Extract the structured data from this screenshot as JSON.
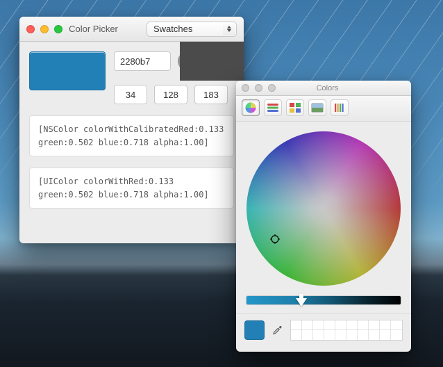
{
  "picker": {
    "title": "Color Picker",
    "dropdown": {
      "selected": "Swatches"
    },
    "hex": "2280b7",
    "rgb": {
      "r": "34",
      "g": "128",
      "b": "183"
    },
    "nscolor_code": "[NSColor colorWithCalibratedRed:0.133 green:0.502 blue:0.718 alpha:1.00]",
    "uicolor_code": "[UIColor colorWithRed:0.133 green:0.502 blue:0.718 alpha:1.00]",
    "swatch_color": "#2280b7"
  },
  "colors_panel": {
    "title": "Colors",
    "current_color": "#2280b7"
  }
}
